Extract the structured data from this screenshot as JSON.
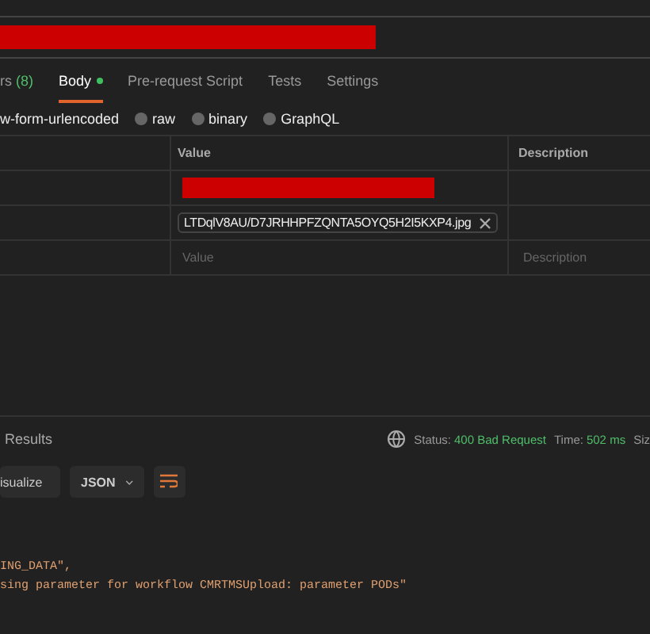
{
  "tabs": [
    {
      "label": "rs",
      "count": "(8)",
      "selected": false,
      "dot": false
    },
    {
      "label": "Body",
      "selected": true,
      "dot": true
    },
    {
      "label": "Pre-request Script",
      "selected": false,
      "dot": false
    },
    {
      "label": "Tests",
      "selected": false,
      "dot": false
    },
    {
      "label": "Settings",
      "selected": false,
      "dot": false
    }
  ],
  "body_types": [
    {
      "label": "w-form-urlencoded",
      "kind": "text"
    },
    {
      "label": "raw",
      "kind": "radio",
      "selected": false
    },
    {
      "label": "binary",
      "kind": "radio",
      "selected": false
    },
    {
      "label": "GraphQL",
      "kind": "radio",
      "selected": false
    }
  ],
  "table": {
    "columns": [
      "Value",
      "Description"
    ],
    "rows": [
      {
        "kind": "redacted"
      },
      {
        "kind": "file",
        "file": "LTDqlV8AU/D7JRHHPFZQNTA5OYQ5H2I5KXP4.jpg"
      },
      {
        "kind": "placeholder",
        "value_placeholder": "Value",
        "description_placeholder": "Description"
      }
    ]
  },
  "response": {
    "tab": "Results",
    "status_label": "Status:",
    "status": "400 Bad Request",
    "time_label": "Time:",
    "time": "502 ms",
    "size_label": "Siz",
    "visualize": "isualize",
    "format": "JSON",
    "code_lines": [
      "ING_DATA\",",
      "sing parameter for workflow CMRTMSUpload: parameter PODs\""
    ]
  }
}
